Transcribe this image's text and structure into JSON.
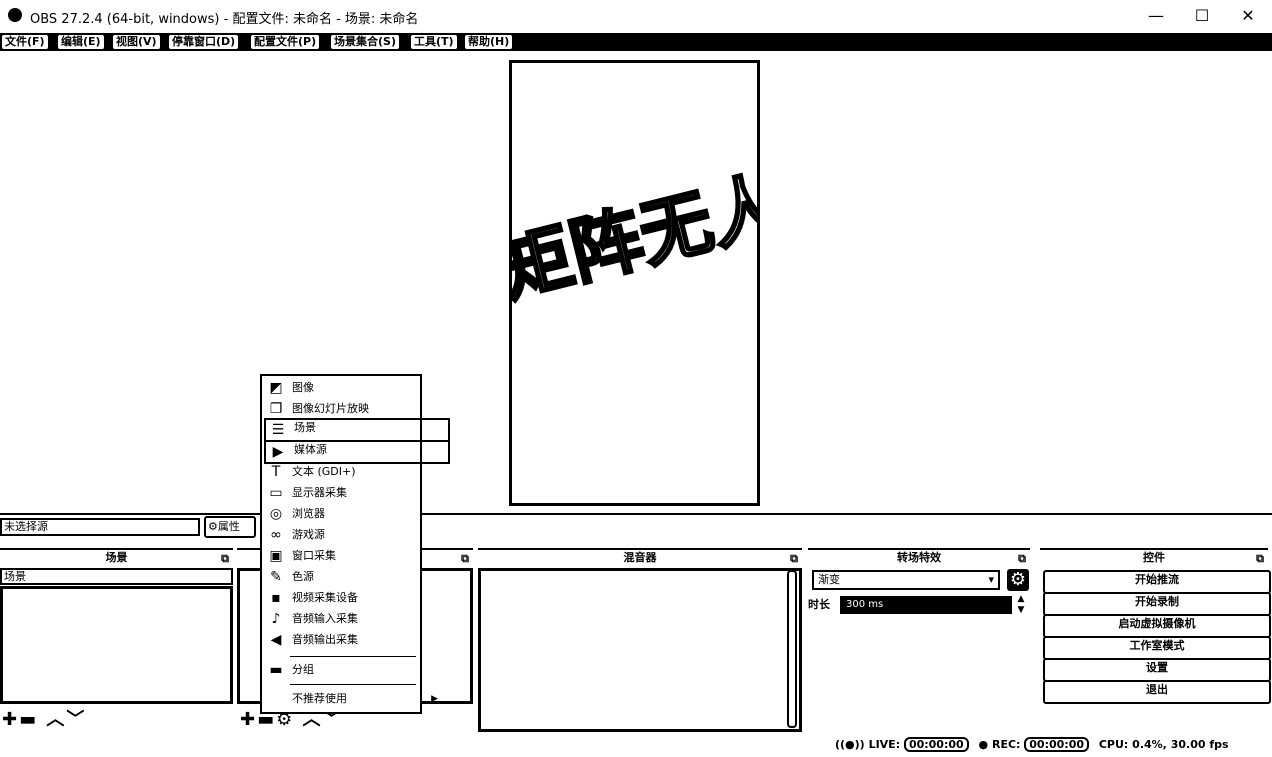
{
  "window": {
    "title": "OBS 27.2.4 (64-bit, windows) - 配置文件: 未命名 - 场景: 未命名",
    "minimize": "—",
    "maximize": "☐",
    "close": "✕"
  },
  "menu": [
    "文件(F)",
    "编辑(E)",
    "视图(V)",
    "停靠窗口(D)",
    "配置文件(P)",
    "场景集合(S)",
    "工具(T)",
    "帮助(H)"
  ],
  "preview": {
    "text": "矩阵无人"
  },
  "source_toolbar": {
    "no_source": "未选择源",
    "properties": "属性"
  },
  "docks": {
    "scenes": {
      "title": "场景",
      "items": [
        "场景"
      ]
    },
    "mixer": {
      "title": "混音器"
    },
    "transitions": {
      "title": "转场特效",
      "selected": "渐变",
      "duration_label": "时长",
      "duration_value": "300 ms"
    },
    "controls": {
      "title": "控件",
      "buttons": [
        "开始推流",
        "开始录制",
        "启动虚拟摄像机",
        "工作室模式",
        "设置",
        "退出"
      ]
    }
  },
  "context_menu": {
    "items": [
      {
        "label": "图像",
        "icon": "image-icon",
        "glyph": "◩"
      },
      {
        "label": "图像幻灯片放映",
        "icon": "slideshow-icon",
        "glyph": "❐"
      },
      {
        "label": "场景",
        "icon": "scene-icon",
        "glyph": "☰"
      },
      {
        "label": "媒体源",
        "icon": "media-icon",
        "glyph": "▶"
      },
      {
        "label": "文本 (GDI+)",
        "icon": "text-icon",
        "glyph": "T"
      },
      {
        "label": "显示器采集",
        "icon": "monitor-icon",
        "glyph": "▭"
      },
      {
        "label": "浏览器",
        "icon": "browser-icon",
        "glyph": "◎"
      },
      {
        "label": "游戏源",
        "icon": "gamepad-icon",
        "glyph": "∞"
      },
      {
        "label": "窗口采集",
        "icon": "window-icon",
        "glyph": "▣"
      },
      {
        "label": "色源",
        "icon": "brush-icon",
        "glyph": "✎"
      },
      {
        "label": "视频采集设备",
        "icon": "camera-icon",
        "glyph": "▪"
      },
      {
        "label": "音频输入采集",
        "icon": "microphone-icon",
        "glyph": "♪"
      },
      {
        "label": "音频输出采集",
        "icon": "speaker-icon",
        "glyph": "◀"
      }
    ],
    "group": {
      "label": "分组",
      "icon": "folder-icon",
      "glyph": "▬"
    },
    "deprecated": {
      "label": "不推荐使用",
      "arrow": "▶"
    }
  },
  "status": {
    "live_label": "LIVE:",
    "live_time": "00:00:00",
    "rec_label": "REC:",
    "rec_time": "00:00:00",
    "cpu_label": "CPU:",
    "cpu_value": "0.4%,",
    "fps": "30.00 fps"
  }
}
